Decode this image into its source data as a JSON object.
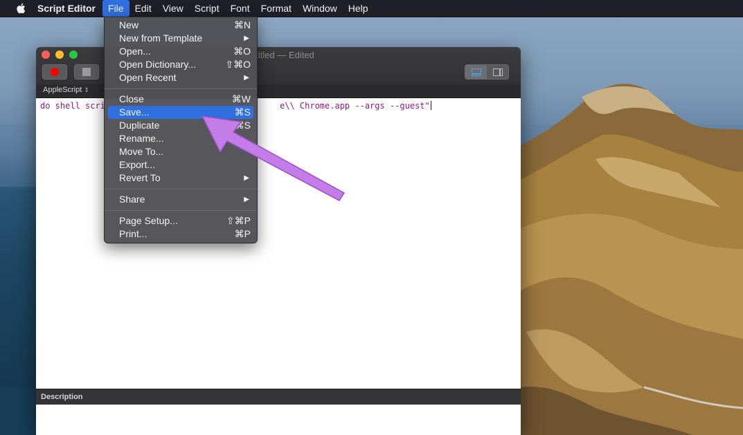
{
  "menubar": {
    "app_name": "Script Editor",
    "menus": [
      "File",
      "Edit",
      "View",
      "Script",
      "Font",
      "Format",
      "Window",
      "Help"
    ],
    "active_menu": "File"
  },
  "window": {
    "title": "ntitled — Edited",
    "language": "AppleScript",
    "code_left": "do shell scri",
    "code_right": "e\\\\ Chrome.app --args --guest\"",
    "description_label": "Description"
  },
  "file_menu": {
    "items": [
      {
        "label": "New",
        "shortcut": "⌘N"
      },
      {
        "label": "New from Template",
        "submenu": "▶"
      },
      {
        "label": "Open...",
        "shortcut": "⌘O"
      },
      {
        "label": "Open Dictionary...",
        "shortcut": "⇧⌘O"
      },
      {
        "label": "Open Recent",
        "submenu": "▶"
      },
      {
        "label": "Close",
        "shortcut": "⌘W"
      },
      {
        "label": "Save...",
        "shortcut": "⌘S",
        "highlighted": true
      },
      {
        "label": "Duplicate",
        "shortcut": "⇧⌘S"
      },
      {
        "label": "Rename..."
      },
      {
        "label": "Move To..."
      },
      {
        "label": "Export..."
      },
      {
        "label": "Revert To",
        "submenu": "▶"
      },
      {
        "label": "Share",
        "submenu": "▶"
      },
      {
        "label": "Page Setup...",
        "shortcut": "⇧⌘P"
      },
      {
        "label": "Print...",
        "shortcut": "⌘P"
      }
    ]
  },
  "colors": {
    "menu_highlight": "#2f6fde",
    "code_text": "#8a1a87",
    "annotation_arrow": "#c47ce8"
  }
}
